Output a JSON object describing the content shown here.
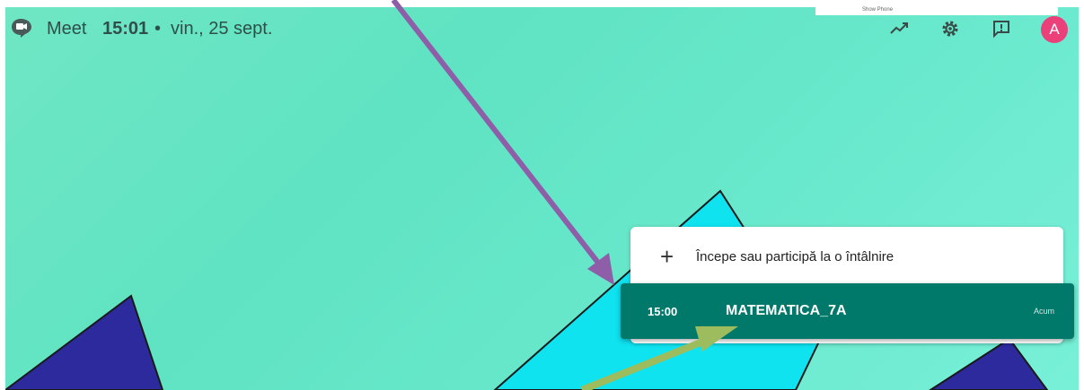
{
  "topbar": {
    "brand": "Meet",
    "time": "15:01",
    "separator": "•",
    "date": "vin., 25 sept.",
    "icons": [
      "meet-logo-icon",
      "trending-icon",
      "gear-icon",
      "feedback-icon"
    ],
    "avatar_letter": "A",
    "avatar_color": "#ec407a"
  },
  "popup": {
    "text": "Show Phone"
  },
  "card": {
    "join_icon": "+",
    "join_label": "Începe sau participă la o întâlnire",
    "meeting": {
      "time": "15:00",
      "title": "MATEMATICA_7A",
      "status": "Acum",
      "color": "#00796b"
    }
  },
  "colors": {
    "background": "#62e4c4",
    "arrow_purple": "#8e5ea8",
    "arrow_green": "#9cbc5e"
  }
}
